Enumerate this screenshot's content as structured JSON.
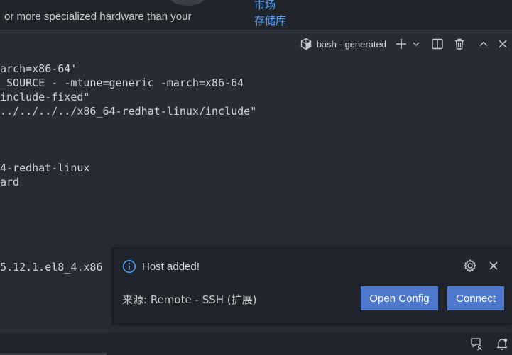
{
  "top": {
    "description_text": "or more specialized hardware than your",
    "link_market": "市场",
    "link_repository": "存储库"
  },
  "terminal": {
    "tab_label": "bash - generated",
    "lines": [
      "arch=x86-64'",
      "_SOURCE - -mtune=generic -march=x86-64",
      "include-fixed\"",
      "../../../../x86_64-redhat-linux/include\"",
      "",
      "",
      "",
      "4-redhat-linux",
      "ard",
      "",
      "",
      "",
      "",
      "5.12.1.el8_4.x86"
    ]
  },
  "notification": {
    "title": "Host added!",
    "source": "来源: Remote - SSH (扩展)",
    "open_config_label": "Open Config",
    "connect_label": "Connect"
  },
  "icons": {
    "terminal_tab": "cube-icon",
    "new_terminal": "plus-icon",
    "dropdown": "chevron-down-icon",
    "split": "split-icon",
    "kill": "trash-icon",
    "maximize": "chevron-up-icon",
    "close_panel": "close-icon",
    "info": "info-icon",
    "settings": "gear-icon",
    "dismiss": "close-icon",
    "feedback": "feedback-icon",
    "notifications": "bell-icon"
  },
  "colors": {
    "background": "#282c34",
    "panel": "#21252b",
    "button": "#4d78cc",
    "link": "#4aa3ff",
    "info": "#4aa3ff"
  }
}
